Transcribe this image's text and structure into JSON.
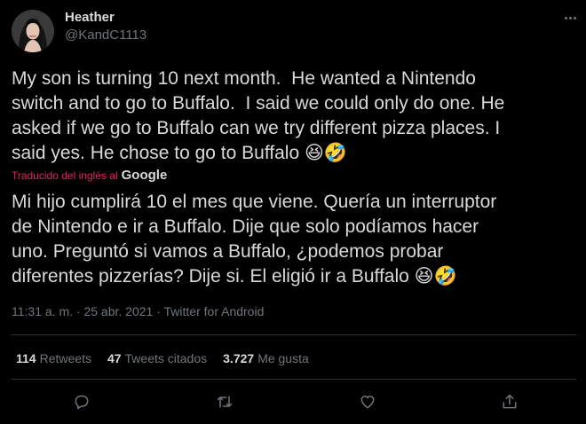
{
  "user": {
    "name": "Heather",
    "handle": "@KandC1113"
  },
  "tweet": {
    "text": "My son is turning 10 next month.  He wanted a Nintendo\nswitch and to go to Buffalo.  I said we could only do one. He\nasked if we go to Buffalo can we try different pizza places. I\nsaid yes. He chose to go to Buffalo 😆🤣",
    "translated_label": "Traducido del inglés al",
    "translator": "Google",
    "translation": "Mi hijo cumplirá 10 el mes que viene. Quería un interruptor\nde Nintendo e ir a Buffalo. Dije que solo podíamos hacer\nuno. Preguntó si vamos a Buffalo, ¿podemos probar\ndiferentes pizzerías? Dije si. El eligió ir a Buffalo 😆🤣",
    "time": "11:31 a. m.",
    "separator": "·",
    "date": "25 abr. 2021",
    "source": "Twitter for Android"
  },
  "stats": {
    "retweets_count": "114",
    "retweets_label": "Retweets",
    "quotes_count": "47",
    "quotes_label": "Tweets citados",
    "likes_count": "3.727",
    "likes_label": "Me gusta"
  },
  "icons": [
    "more-icon",
    "reply-icon",
    "retweet-icon",
    "like-icon",
    "share-icon"
  ],
  "colors": {
    "background": "#000000",
    "text": "#d9d9d9",
    "muted": "#6e767d",
    "translate_accent": "#e0245e",
    "divider": "#2f3336"
  }
}
